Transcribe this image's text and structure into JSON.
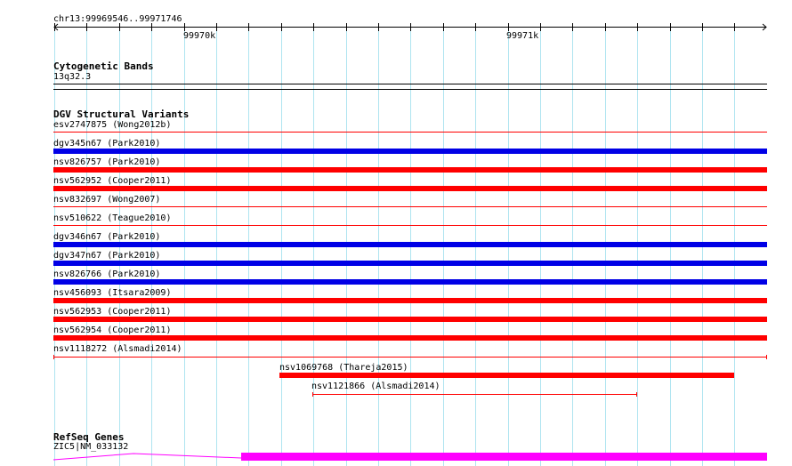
{
  "ruler": {
    "locus": "chr13:99969546..99971746",
    "ticks": [
      "99970k",
      "99971k"
    ]
  },
  "tracks": {
    "cytoband": {
      "title": "Cytogenetic Bands",
      "band": "13q32.3"
    },
    "dgv": {
      "title": "DGV Structural Variants",
      "features": [
        {
          "id": "esv2747875",
          "source": "(Wong2012b)",
          "color": "#ff0000",
          "style": "line"
        },
        {
          "id": "dgv345n67",
          "source": "(Park2010)",
          "color": "#0000e6",
          "style": "bar"
        },
        {
          "id": "nsv826757",
          "source": "(Park2010)",
          "color": "#ff0000",
          "style": "bar"
        },
        {
          "id": "nsv562952",
          "source": "(Cooper2011)",
          "color": "#ff0000",
          "style": "bar"
        },
        {
          "id": "nsv832697",
          "source": "(Wong2007)",
          "color": "#ff0000",
          "style": "line"
        },
        {
          "id": "nsv510622",
          "source": "(Teague2010)",
          "color": "#ff0000",
          "style": "line"
        },
        {
          "id": "dgv346n67",
          "source": "(Park2010)",
          "color": "#0000e6",
          "style": "bar"
        },
        {
          "id": "dgv347n67",
          "source": "(Park2010)",
          "color": "#0000e6",
          "style": "bar"
        },
        {
          "id": "nsv826766",
          "source": "(Park2010)",
          "color": "#0000e6",
          "style": "bar"
        },
        {
          "id": "nsv456093",
          "source": "(Itsara2009)",
          "color": "#ff0000",
          "style": "bar"
        },
        {
          "id": "nsv562953",
          "source": "(Cooper2011)",
          "color": "#ff0000",
          "style": "bar"
        },
        {
          "id": "nsv562954",
          "source": "(Cooper2011)",
          "color": "#ff0000",
          "style": "bar"
        },
        {
          "id": "nsv1118272",
          "source": "(Alsmadi2014)",
          "color": "#ff0000",
          "style": "capped"
        },
        {
          "id": "nsv1069768",
          "source": "(Thareja2015)",
          "color": "#ff0000",
          "style": "bar"
        },
        {
          "id": "nsv1121866",
          "source": "(Alsmadi2014)",
          "color": "#ff0000",
          "style": "capped"
        }
      ]
    },
    "refseq": {
      "title": "RefSeq Genes",
      "gene": "ZIC5|NM_033132",
      "color": "#ff00ff"
    }
  },
  "colors": {
    "grid": "#aee4f0",
    "red": "#ff0000",
    "blue": "#0000e6",
    "magenta": "#ff00ff"
  }
}
